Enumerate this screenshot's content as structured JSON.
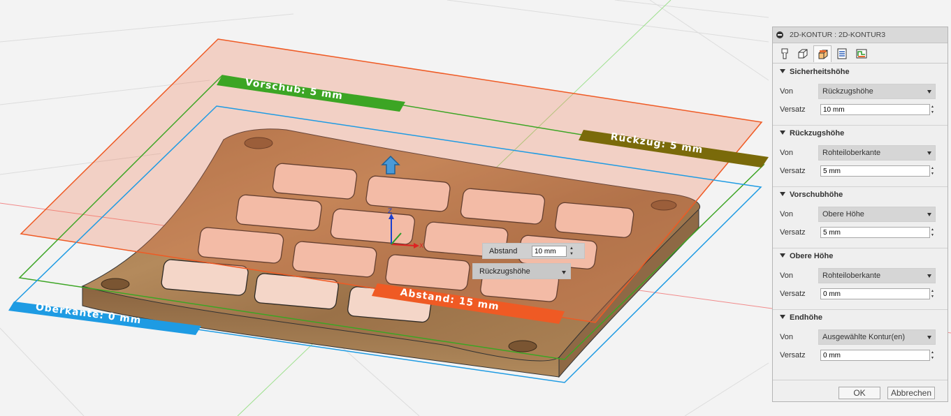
{
  "viewport": {
    "labels": {
      "feed": "Vorschub: 5 mm",
      "retract": "Rückzug: 5 mm",
      "top": "Oberkante: 0 mm",
      "clearance": "Abstand: 15 mm"
    },
    "axes": {
      "z": "Z",
      "x": "X"
    },
    "tooltip": {
      "label": "Abstand",
      "value": "10 mm",
      "dropdown": "Rückzugshöhe"
    },
    "colors": {
      "clearance": "#ef5a24",
      "feed": "#3ca524",
      "retract": "#7a6a0a",
      "top": "#1e9be3",
      "wood": "#a67c52"
    }
  },
  "panel": {
    "title": "2D-KONTUR : 2D-KONTUR3",
    "tabs": [
      "tool-icon",
      "geometry-icon",
      "heights-icon",
      "passes-icon",
      "linking-icon"
    ],
    "sections": [
      {
        "title": "Sicherheitshöhe",
        "from_label": "Von",
        "from_value": "Rückzugshöhe",
        "offset_label": "Versatz",
        "offset_value": "10 mm"
      },
      {
        "title": "Rückzugshöhe",
        "from_label": "Von",
        "from_value": "Rohteiloberkante",
        "offset_label": "Versatz",
        "offset_value": "5 mm"
      },
      {
        "title": "Vorschubhöhe",
        "from_label": "Von",
        "from_value": "Obere Höhe",
        "offset_label": "Versatz",
        "offset_value": "5 mm"
      },
      {
        "title": "Obere Höhe",
        "from_label": "Von",
        "from_value": "Rohteiloberkante",
        "offset_label": "Versatz",
        "offset_value": "0 mm"
      },
      {
        "title": "Endhöhe",
        "from_label": "Von",
        "from_value": "Ausgewählte Kontur(en)",
        "offset_label": "Versatz",
        "offset_value": "0 mm"
      }
    ],
    "ok": "OK",
    "cancel": "Abbrechen"
  }
}
